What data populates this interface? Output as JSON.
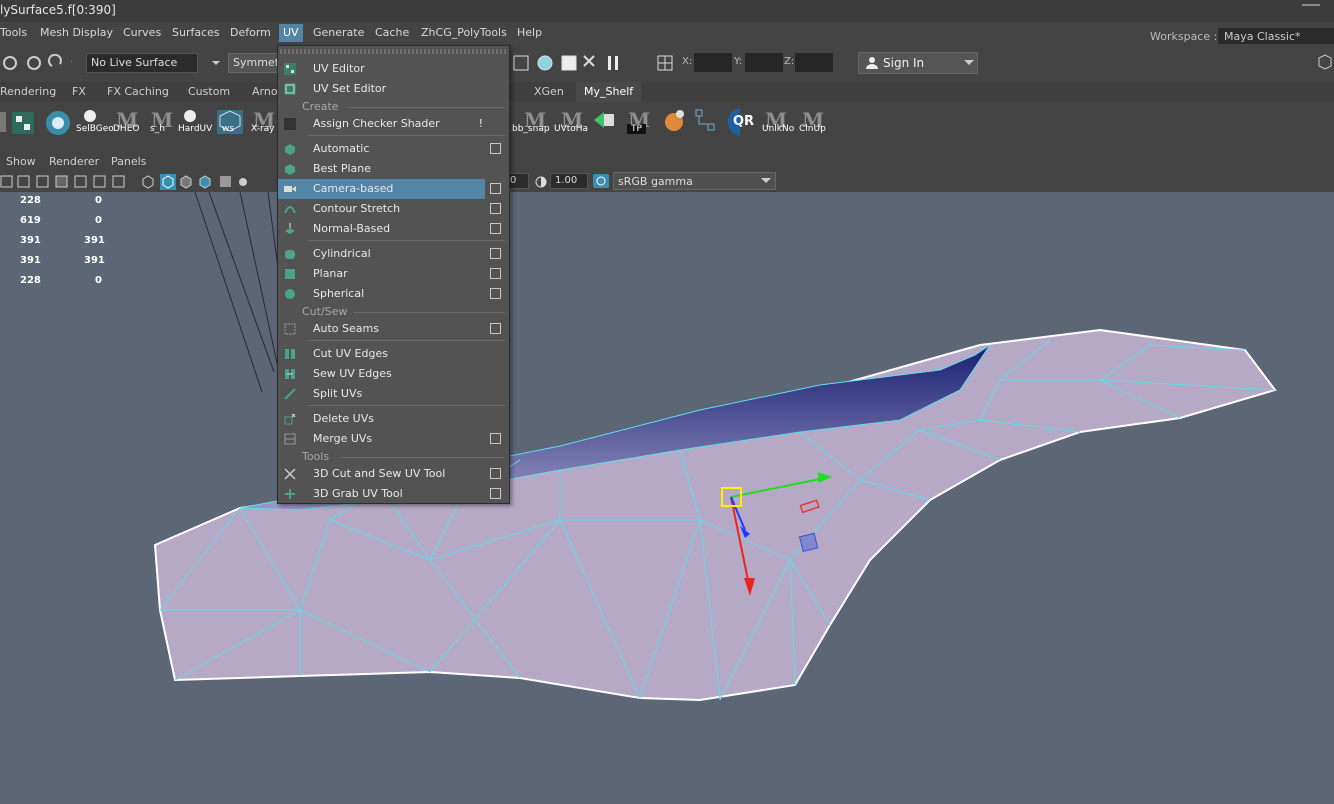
{
  "window": {
    "title": "lySurface5.f[0:390]"
  },
  "menubar": {
    "items": [
      "Tools",
      "Mesh Display",
      "Curves",
      "Surfaces",
      "Deform",
      "UV",
      "Generate",
      "Cache",
      "ZhCG_PolyTools",
      "Help"
    ],
    "active": "UV",
    "workspace_label": "Workspace :",
    "workspace_value": "Maya Classic*"
  },
  "statusline": {
    "live_surface": "No Live Surface",
    "symmetry": "Symmetr",
    "x_label": "X:",
    "y_label": "Y:",
    "z_label": "Z:",
    "sign_in": "Sign In"
  },
  "shelf": {
    "tabs": [
      "Rendering",
      "FX",
      "FX Caching",
      "Custom",
      "Arno",
      "XGen",
      "My_Shelf"
    ],
    "active_tab": "My_Shelf",
    "buttons": [
      "SelBGeo",
      "DHEO",
      "s_h",
      "HardUV",
      "ws",
      "X-ray",
      "bb_snap",
      "UVtoHa",
      "TP",
      "UnlkNo",
      "ClnUp"
    ]
  },
  "panel": {
    "menu": [
      "Show",
      "Renderer",
      "Panels"
    ],
    "exposure": "0",
    "gamma": "1.00",
    "colorspace": "sRGB gamma"
  },
  "hud": [
    [
      "228",
      "0"
    ],
    [
      "619",
      "0"
    ],
    [
      "391",
      "391"
    ],
    [
      "391",
      "391"
    ],
    [
      "228",
      "0"
    ]
  ],
  "uv_menu": {
    "items": [
      {
        "label": "UV Editor",
        "option": false
      },
      {
        "label": "UV Set Editor",
        "option": false
      },
      {
        "section": "Create"
      },
      {
        "label": "Assign Checker Shader",
        "option": false,
        "bang": "!"
      },
      {
        "label": "Automatic",
        "option": true
      },
      {
        "label": "Best Plane",
        "option": false
      },
      {
        "label": "Camera-based",
        "option": true,
        "highlighted": true
      },
      {
        "label": "Contour Stretch",
        "option": true
      },
      {
        "label": "Normal-Based",
        "option": true
      },
      {
        "label": "Cylindrical",
        "option": true
      },
      {
        "label": "Planar",
        "option": true
      },
      {
        "label": "Spherical",
        "option": true
      },
      {
        "section": "Cut/Sew"
      },
      {
        "label": "Auto Seams",
        "option": true
      },
      {
        "label": "Cut UV Edges",
        "option": false
      },
      {
        "label": "Sew UV Edges",
        "option": false
      },
      {
        "label": "Split UVs",
        "option": false
      },
      {
        "label": "Delete UVs",
        "option": false
      },
      {
        "label": "Merge UVs",
        "option": true
      },
      {
        "section": "Tools"
      },
      {
        "label": "3D Cut and Sew UV Tool",
        "option": true
      },
      {
        "label": "3D Grab UV Tool",
        "option": true
      }
    ]
  },
  "colors": {
    "accent": "#5285a6",
    "viewport_bg": "#5c6675",
    "mesh_fill": "#b7a9c6",
    "wire": "#5fdcef"
  }
}
